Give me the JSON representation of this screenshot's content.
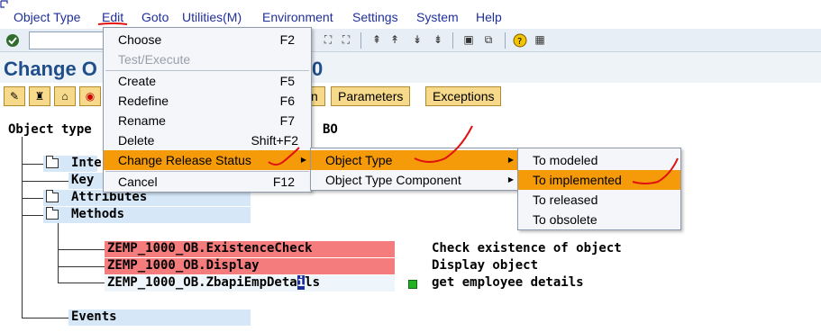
{
  "menubar": {
    "items": [
      "Object Type",
      "Edit",
      "Goto",
      "Utilities(M)",
      "Environment",
      "Settings",
      "System",
      "Help"
    ]
  },
  "title": {
    "prefix": "Change O",
    "suffix": "0"
  },
  "app_toolbar": {
    "partial_button": "n",
    "parameters": "Parameters",
    "exceptions": "Exceptions"
  },
  "tree": {
    "header_label": "Object type",
    "header_value": "BO",
    "nodes": {
      "interfaces": "Inte",
      "key": "Key",
      "attributes": "Attributes",
      "methods": "Methods",
      "events": "Events"
    },
    "methods": [
      {
        "name": "ZEMP_1000_OB.ExistenceCheck",
        "desc": "Check existence of object",
        "status": "red"
      },
      {
        "name": "ZEMP_1000_OB.Display",
        "desc": "Display object",
        "status": "red"
      },
      {
        "name_before": "ZEMP_1000_OB.ZbapiEmpDeta",
        "name_cursor": "i",
        "name_after": "ls",
        "desc": "get employee details",
        "status": "green"
      }
    ]
  },
  "edit_menu": {
    "items": [
      {
        "label": "Choose",
        "shortcut": "F2"
      },
      {
        "label": "Test/Execute",
        "shortcut": "",
        "disabled": true
      },
      {
        "label": "Create",
        "shortcut": "F5"
      },
      {
        "label": "Redefine",
        "shortcut": "F6"
      },
      {
        "label": "Rename",
        "shortcut": "F7"
      },
      {
        "label": "Delete",
        "shortcut": "Shift+F2"
      },
      {
        "label": "Change Release Status",
        "shortcut": ""
      },
      {
        "label": "Cancel",
        "shortcut": "F12"
      }
    ]
  },
  "release_submenu": {
    "items": [
      "Object Type",
      "Object Type Component"
    ]
  },
  "status_submenu": {
    "items": [
      "To modeled",
      "To implemented",
      "To released",
      "To obsolete"
    ]
  },
  "colors": {
    "menu_highlight": "#f59a08",
    "method_red": "#f57c7c",
    "node_blue": "#d6e8f8",
    "title_blue": "#1f4e8a",
    "status_green": "#21b321",
    "annotation_red": "#e01010"
  },
  "icons": [
    "check-icon",
    "save-icon",
    "back-icon",
    "exit-icon",
    "cancel-icon",
    "print-icon",
    "find-icon",
    "find-next-icon",
    "first-page-icon",
    "prev-page-icon",
    "next-page-icon",
    "last-page-icon",
    "new-session-icon",
    "shortcut-icon",
    "help-icon",
    "customize-icon"
  ]
}
